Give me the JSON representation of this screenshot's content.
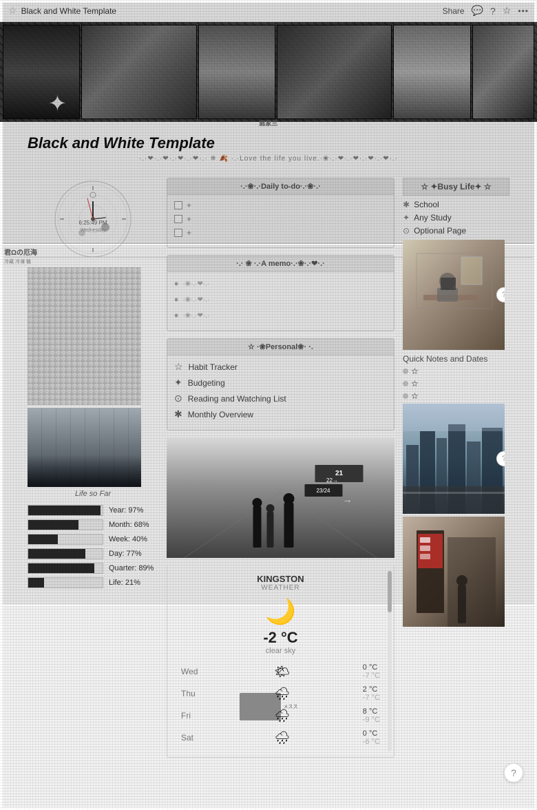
{
  "topbar": {
    "title": "Black and White Template",
    "share_label": "Share",
    "star_icon": "☆",
    "comment_icon": "💬",
    "help_icon": "?",
    "more_icon": "•••"
  },
  "page": {
    "title": "Black and White Template",
    "decorative": "·.·❤·.·❤·.·❤·.·❤·.· ❄ 🍂 ·.·Love the life you live.·❀·.·❤·.·❤·.·❤·.·❤·.·"
  },
  "clock": {
    "time": "6:25:49 PM",
    "day": "Wednesday"
  },
  "photos": {
    "caption": "Life so Far"
  },
  "progress": {
    "items": [
      {
        "label": "Year: 97%",
        "value": 97
      },
      {
        "label": "Month: 68%",
        "value": 68
      },
      {
        "label": "Week: 40%",
        "value": 40
      },
      {
        "label": "Day: 77%",
        "value": 77
      },
      {
        "label": "Quarter: 89%",
        "value": 89
      },
      {
        "label": "Life: 21%",
        "value": 21
      }
    ]
  },
  "daily_todo": {
    "header": "·.·❀·.·Daily to-do·.·❀·.·",
    "items": [
      {
        "checked": false,
        "text": "+"
      },
      {
        "checked": false,
        "text": "+"
      },
      {
        "checked": false,
        "text": "+"
      }
    ]
  },
  "memo": {
    "header": "·.· ❀ ·.·A memo·.·❀·.·❤·.·",
    "items": [
      {
        "text": "·❀·.·❤·.·"
      },
      {
        "text": "·❀·.·❤·.·"
      },
      {
        "text": "·❀·.·❤·.·"
      }
    ]
  },
  "personal": {
    "header": "☆ ·❀Personal❀· ·.",
    "items": [
      {
        "icon": "☆",
        "label": "Habit Tracker"
      },
      {
        "icon": "✦",
        "label": "Budgeting"
      },
      {
        "icon": "⊙",
        "label": "Reading and Watching List"
      },
      {
        "icon": "✱",
        "label": "Monthly Overview"
      }
    ]
  },
  "busy_life": {
    "header": "☆ ✦Busy Life✦ ☆",
    "items": [
      {
        "icon": "✱",
        "label": "School"
      },
      {
        "icon": "✦",
        "label": "Any Study"
      },
      {
        "icon": "⊙",
        "label": "Optional Page"
      }
    ]
  },
  "quick_notes": {
    "title": "Quick Notes and Dates",
    "items": [
      {
        "text": "☆"
      },
      {
        "text": "☆"
      },
      {
        "text": "☆"
      }
    ]
  },
  "weather": {
    "city": "KINGSTON",
    "label": "WEATHER",
    "icon": "🌙",
    "temp": "-2 °C",
    "desc": "clear sky",
    "forecast": [
      {
        "day": "Wed",
        "icon": "🌤",
        "hi": "0 °C",
        "lo": "-7 °C"
      },
      {
        "day": "Thu",
        "icon": "🌧",
        "hi": "2 °C",
        "lo": "-7 °C"
      },
      {
        "day": "Fri",
        "icon": "🌧",
        "hi": "8 °C",
        "lo": "-9 °C"
      },
      {
        "day": "Sat",
        "icon": "🌧",
        "hi": "0 °C",
        "lo": "-6 °C"
      }
    ]
  }
}
